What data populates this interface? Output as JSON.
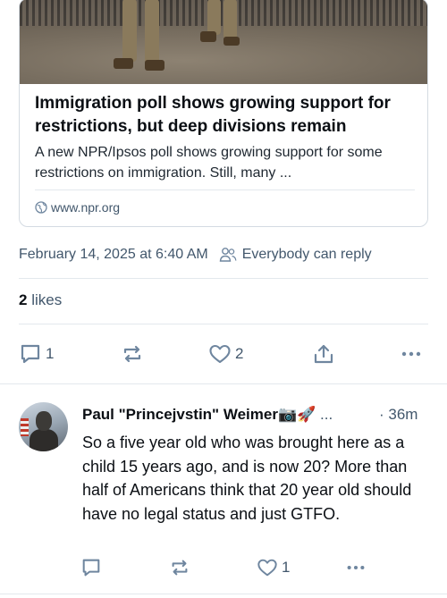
{
  "link_card": {
    "title": "Immigration poll shows growing support for restrictions, but deep divisions remain",
    "description": "A new NPR/Ipsos poll shows growing support for some restrictions on immigration. Still, many ...",
    "domain": "www.npr.org"
  },
  "post_meta": {
    "timestamp": "February 14, 2025 at 6:40 AM",
    "reply_setting": "Everybody can reply"
  },
  "likes": {
    "count": "2",
    "label": "likes"
  },
  "main_actions": {
    "reply_count": "1",
    "like_count": "2"
  },
  "reply": {
    "author": "Paul \"Princejvstin\" Weimer📷🚀",
    "author_ellipsis": " ...",
    "time": "· 36m",
    "text": "So a five year old who was brought here as a child 15 years ago, and is now 20? More than half of Americans think that 20 year old should have no legal status and just GTFO.",
    "like_count": "1"
  },
  "colors": {
    "text": "#0b0f14",
    "muted": "#42576c",
    "icon": "#6f869f",
    "border": "#e3e8ed"
  },
  "icons": [
    "globe-icon",
    "people-icon",
    "reply-icon",
    "repost-icon",
    "heart-icon",
    "share-icon",
    "more-icon"
  ]
}
